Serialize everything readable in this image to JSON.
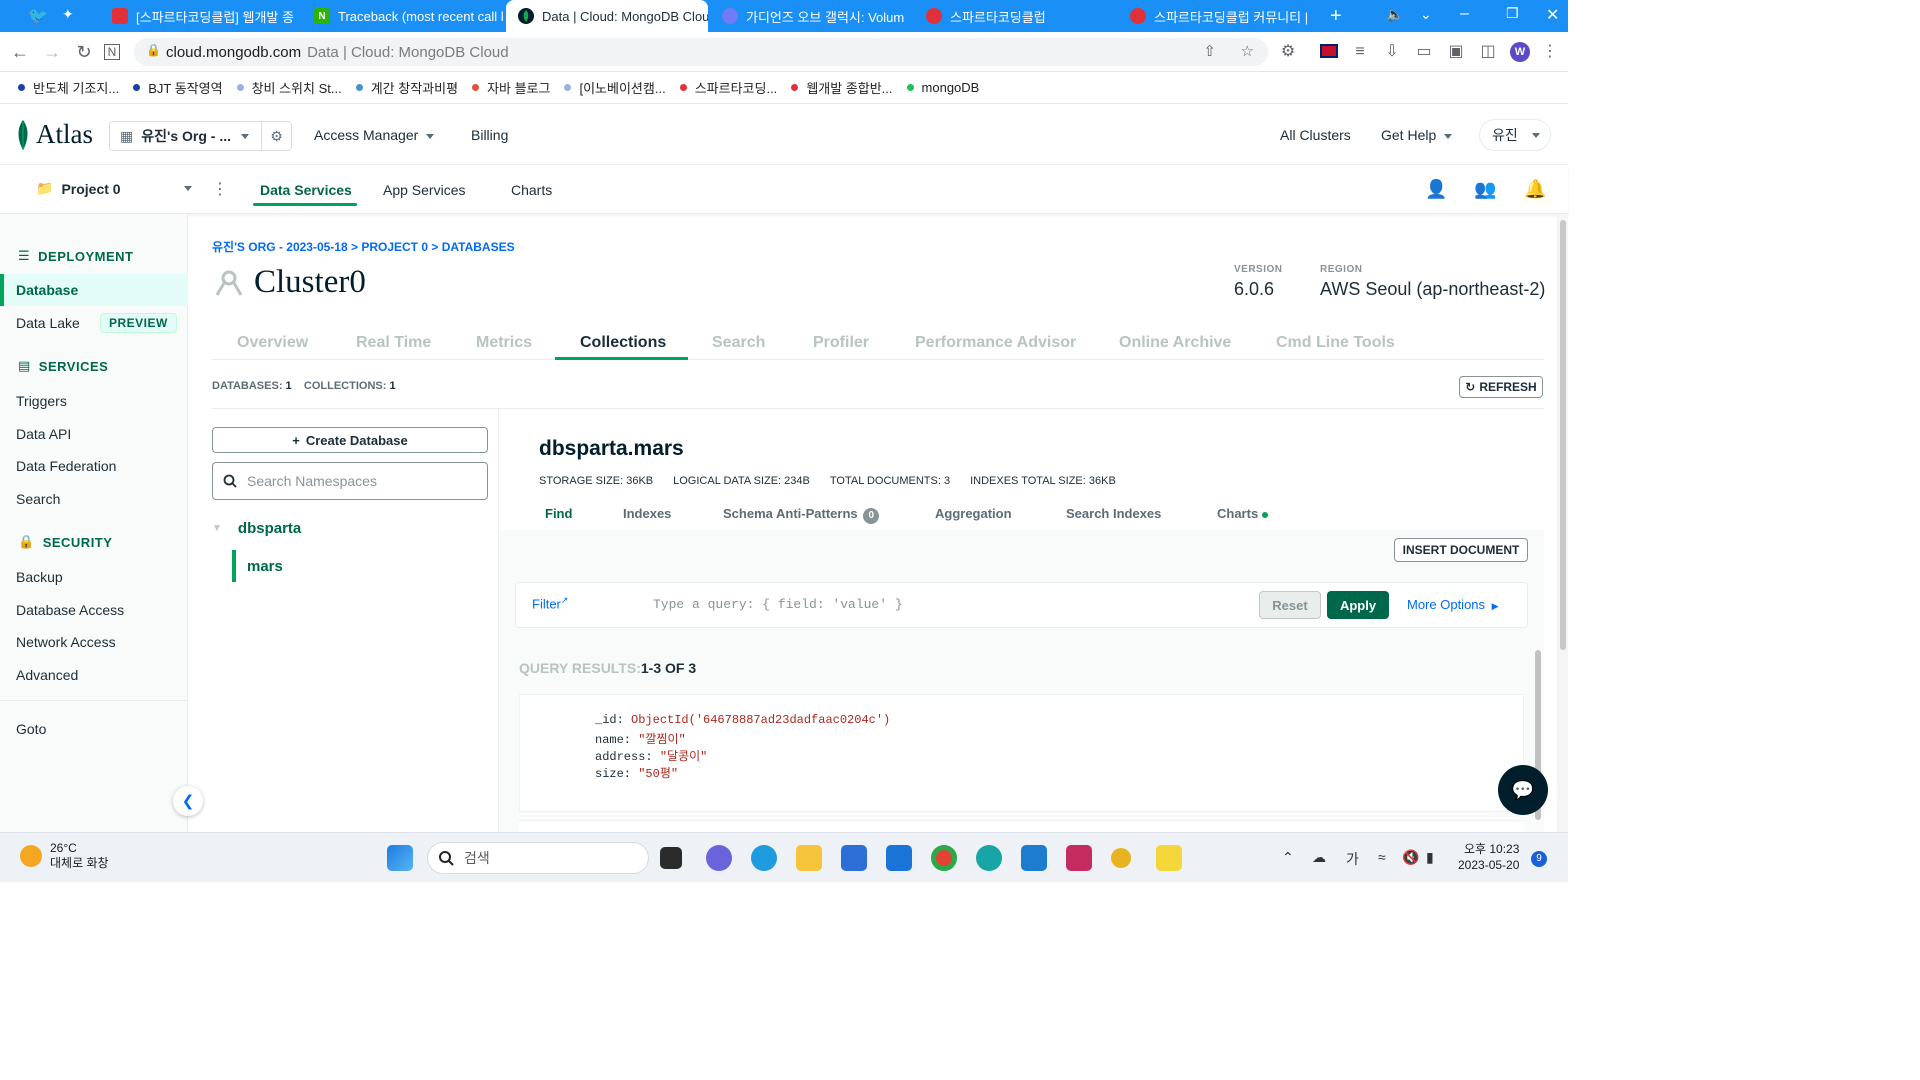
{
  "browser": {
    "tabs": [
      {
        "label": "[스파르타코딩클럽] 웹개발 종",
        "favicon_color": "#e0313b"
      },
      {
        "label": "Traceback (most recent call l",
        "favicon_color": "#2db400",
        "favicon_text": "N"
      },
      {
        "label": "Data | Cloud: MongoDB Clou",
        "favicon_color": "#001e2b",
        "active": true
      },
      {
        "label": "가디언즈 오브 갤럭시: Volum",
        "favicon_color": "#6f7cf5"
      },
      {
        "label": "스파르타코딩클럽",
        "favicon_color": "#e0313b"
      },
      {
        "label": "스파르타코딩클럽 커뮤니티 |",
        "favicon_color": "#e0313b"
      }
    ],
    "url_host": "cloud.mongodb.com",
    "url_title": "Data | Cloud: MongoDB Cloud",
    "profile_initial": "W",
    "bookmarks": [
      {
        "label": "반도체 기조지...",
        "color": "#1a3fa8"
      },
      {
        "label": "BJT 동작영역",
        "color": "#1a3fa8"
      },
      {
        "label": "창비 스위치 St...",
        "color": "#9ab0e0"
      },
      {
        "label": "계간 창작과비평",
        "color": "#4a8fd0"
      },
      {
        "label": "자바 블로그",
        "color": "#e0513b"
      },
      {
        "label": "[이노베이션캠...",
        "color": "#9ab0e0"
      },
      {
        "label": "스파르타코딩...",
        "color": "#e0313b"
      },
      {
        "label": "웹개발 종합반...",
        "color": "#e0313b"
      },
      {
        "label": "mongoDB",
        "color": "#13c55b"
      }
    ]
  },
  "atlas": {
    "logo": "Atlas",
    "org": "유진's Org - ...",
    "access_manager": "Access Manager",
    "billing": "Billing",
    "all_clusters": "All Clusters",
    "get_help": "Get Help",
    "user": "유진",
    "project": "Project 0",
    "project_tabs": [
      "Data Services",
      "App Services",
      "Charts"
    ]
  },
  "sidebar": {
    "deployment": "DEPLOYMENT",
    "database": "Database",
    "data_lake": "Data Lake",
    "preview": "PREVIEW",
    "services": "SERVICES",
    "services_items": [
      "Triggers",
      "Data API",
      "Data Federation",
      "Search"
    ],
    "security": "SECURITY",
    "security_items": [
      "Backup",
      "Database Access",
      "Network Access",
      "Advanced"
    ],
    "goto": "Goto"
  },
  "main": {
    "breadcrumb": "유진'S ORG - 2023-05-18 > PROJECT 0 > DATABASES",
    "cluster": "Cluster0",
    "version_label": "VERSION",
    "version": "6.0.6",
    "region_label": "REGION",
    "region": "AWS Seoul (ap-northeast-2)",
    "cluster_tabs": [
      "Overview",
      "Real Time",
      "Metrics",
      "Collections",
      "Search",
      "Profiler",
      "Performance Advisor",
      "Online Archive",
      "Cmd Line Tools"
    ],
    "databases_label": "DATABASES:",
    "databases_count": "1",
    "collections_label": "COLLECTIONS:",
    "collections_count": "1",
    "refresh": "REFRESH",
    "create_database": "Create Database",
    "search_placeholder": "Search Namespaces",
    "tree_db": "dbsparta",
    "tree_collection": "mars",
    "collection_name": "dbsparta.mars",
    "stats": [
      "STORAGE SIZE: 36KB",
      "LOGICAL DATA SIZE: 234B",
      "TOTAL DOCUMENTS: 3",
      "INDEXES TOTAL SIZE: 36KB"
    ],
    "sub_tabs": [
      "Find",
      "Indexes",
      "Schema Anti-Patterns",
      "Aggregation",
      "Search Indexes",
      "Charts"
    ],
    "anti_patterns_count": "0",
    "insert_document": "INSERT DOCUMENT",
    "filter_label": "Filter",
    "filter_placeholder": "Type a query: { field: 'value' }",
    "reset": "Reset",
    "apply": "Apply",
    "more_options": "More Options",
    "query_results_label": "QUERY RESULTS:",
    "query_results_value": "1-3 OF 3",
    "document": [
      {
        "key": "_id:",
        "value": "ObjectId('64678887ad23dadfaac0204c')"
      },
      {
        "key": "name:",
        "value": "\"깔찜이\""
      },
      {
        "key": "address:",
        "value": "\"달콩이\""
      },
      {
        "key": "size:",
        "value": "\"50평\""
      }
    ]
  },
  "taskbar": {
    "temperature": "26°C",
    "weather": "대체로 화창",
    "search": "검색",
    "ime": "가",
    "time": "오후 10:23",
    "date": "2023-05-20",
    "notifications": "9"
  }
}
